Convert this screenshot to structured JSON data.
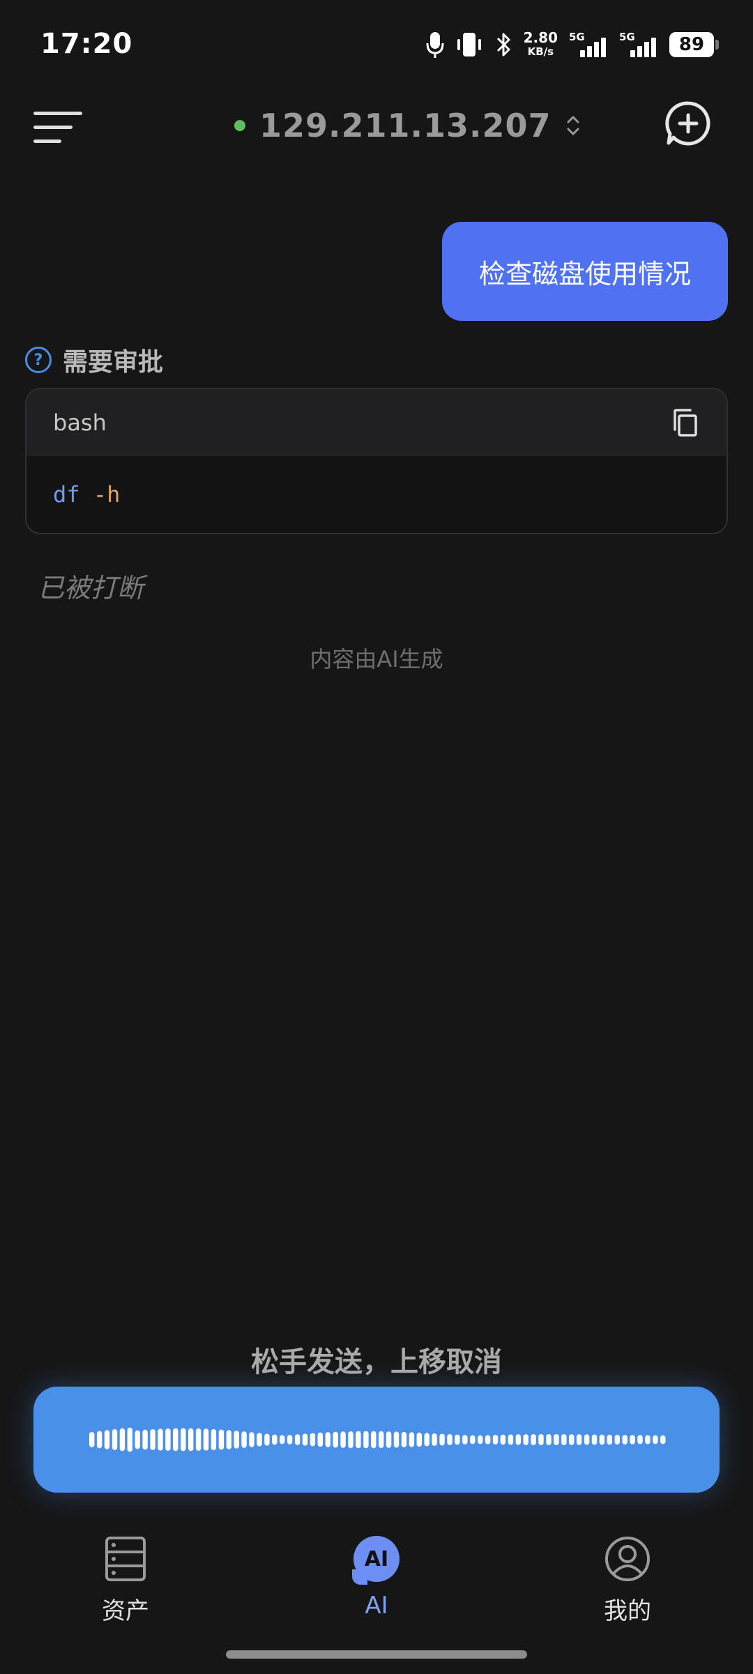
{
  "status_bar": {
    "time": "17:20",
    "net_speed": "2.80",
    "net_unit": "KB/s",
    "sim1_label": "5G",
    "sim2_label": "5G",
    "battery": "89",
    "icons": [
      "microphone-icon",
      "vibrate-icon",
      "bluetooth-icon",
      "signal-icon",
      "battery-icon"
    ]
  },
  "header": {
    "server_ip": "129.211.13.207",
    "status_color": "#5fbf5f",
    "icons": [
      "menu-icon",
      "chevron-updown-icon",
      "add-chat-icon"
    ]
  },
  "chat": {
    "user_message": "检查磁盘使用情况",
    "approval_title": "需要审批",
    "code": {
      "language": "bash",
      "command": "df",
      "flag": "-h"
    },
    "interrupted_text": "已被打断",
    "ai_disclaimer": "内容由AI生成"
  },
  "voice": {
    "hint": "松手发送，上移取消",
    "bar_color": "#4a90e8"
  },
  "nav": {
    "items": [
      {
        "label": "资产",
        "icon": "server-stack-icon"
      },
      {
        "label": "AI",
        "icon": "ai-chat-icon"
      },
      {
        "label": "我的",
        "icon": "user-circle-icon"
      }
    ],
    "active_index": 1,
    "accent": "#6d8ef3"
  },
  "colors": {
    "background": "#161617",
    "user_bubble": "#4e72f2"
  }
}
